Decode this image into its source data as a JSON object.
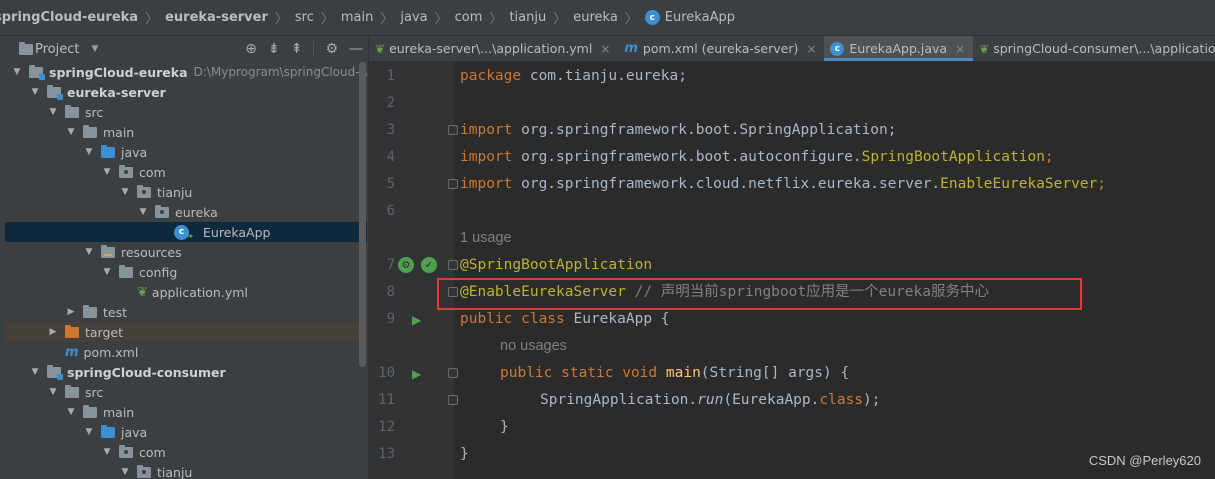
{
  "breadcrumb": {
    "items": [
      "springCloud-eureka",
      "eureka-server",
      "src",
      "main",
      "java",
      "com",
      "tianju",
      "eureka",
      "EurekaApp"
    ]
  },
  "project_panel": {
    "title": "Project",
    "tree": [
      {
        "label": "springCloud-eureka",
        "path": "D:\\Myprogram\\springCloud-wor"
      },
      {
        "label": "eureka-server"
      },
      {
        "label": "src"
      },
      {
        "label": "main"
      },
      {
        "label": "java"
      },
      {
        "label": "com"
      },
      {
        "label": "tianju"
      },
      {
        "label": "eureka"
      },
      {
        "label": "EurekaApp"
      },
      {
        "label": "resources"
      },
      {
        "label": "config"
      },
      {
        "label": "application.yml"
      },
      {
        "label": "test"
      },
      {
        "label": "target"
      },
      {
        "label": "pom.xml"
      },
      {
        "label": "springCloud-consumer"
      },
      {
        "label": "src"
      },
      {
        "label": "main"
      },
      {
        "label": "java"
      },
      {
        "label": "com"
      },
      {
        "label": "tianju"
      }
    ]
  },
  "tabs": [
    {
      "label": "eureka-server\\...\\application.yml"
    },
    {
      "label": "pom.xml (eureka-server)"
    },
    {
      "label": "EurekaApp.java"
    },
    {
      "label": "springCloud-consumer\\...\\application.yml"
    }
  ],
  "editor": {
    "line_numbers": [
      "1",
      "2",
      "3",
      "4",
      "5",
      "6",
      "7",
      "8",
      "9",
      "10",
      "11",
      "12",
      "13"
    ],
    "hints": {
      "usage": "1 usage",
      "no_usages": "no usages"
    },
    "code": {
      "l1_kw": "package",
      "l1_rest": " com.tianju.eureka;",
      "import_kw": "import",
      "l3_rest": " org.springframework.boot.SpringApplication;",
      "l4_pre": " org.springframework.boot.autoconfigure.",
      "l4_cls": "SpringBootApplication",
      "l4_end": ";",
      "l5_pre": " org.springframework.cloud.netflix.eureka.server.",
      "l5_cls": "EnableEurekaServer",
      "l5_end": ";",
      "l7_ann": "@SpringBootApplication",
      "l8_ann": "@EnableEurekaServer",
      "l8_comment": " // 声明当前springboot应用是一个eureka服务中心",
      "l9_kw": "public class",
      "l9_rest": " EurekaApp {",
      "l10_kw": "public static void",
      "l10_fn": "main",
      "l10_rest": "(String[] args) {",
      "l11_pre": "SpringApplication.",
      "l11_run": "run",
      "l11_mid": "(EurekaApp.",
      "l11_kw": "class",
      "l11_end": ");",
      "l12": "}",
      "l13": "}"
    }
  },
  "watermark": "CSDN @Perley620",
  "colors": {
    "highlight_border": "#e23b36",
    "keyword": "#cc7832",
    "annotation": "#bbb529",
    "comment": "#808080"
  }
}
